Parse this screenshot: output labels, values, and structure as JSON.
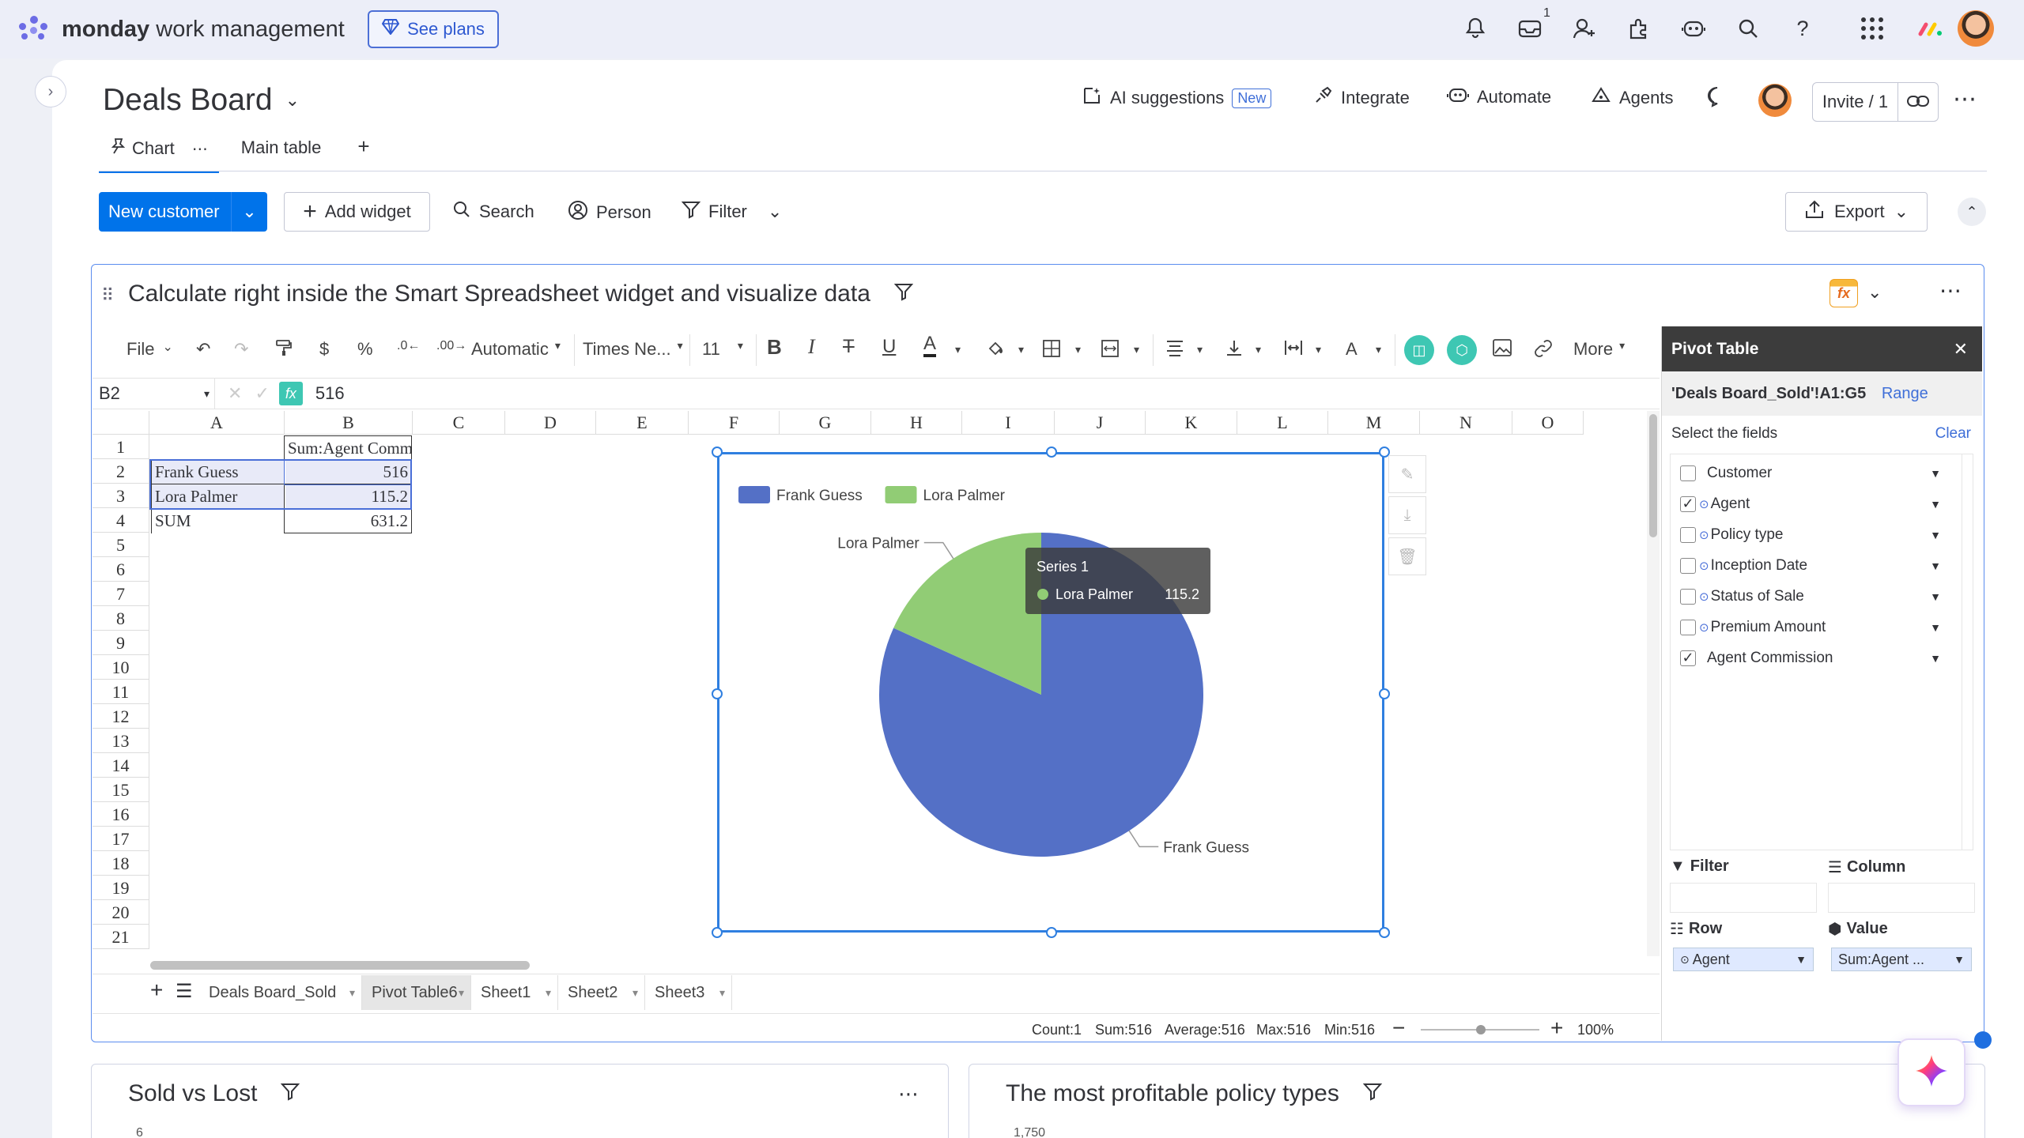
{
  "app": {
    "brand_bold": "monday",
    "brand_rest": " work management",
    "see_plans": "See plans",
    "inbox_badge": "1"
  },
  "board": {
    "title": "Deals Board",
    "ai_suggestions": "AI suggestions",
    "new_badge": "New",
    "integrate": "Integrate",
    "automate": "Automate",
    "agents": "Agents",
    "invite": "Invite / 1"
  },
  "tabs": [
    {
      "label": "Chart",
      "active": true
    },
    {
      "label": "Main table",
      "active": false
    }
  ],
  "toolbar": {
    "new_customer": "New customer",
    "add_widget": "Add widget",
    "search": "Search",
    "person": "Person",
    "filter": "Filter",
    "export": "Export"
  },
  "widget": {
    "title": "Calculate right inside the Smart Spreadsheet widget and visualize data"
  },
  "ss_toolbar": {
    "file": "File",
    "dollar": "$",
    "percent": "%",
    "format": "Automatic",
    "font": "Times Ne...",
    "size": "11",
    "more": "More"
  },
  "formula": {
    "cell_ref": "B2",
    "fx": "fx",
    "value": "516"
  },
  "sheet": {
    "columns": [
      "A",
      "B",
      "C",
      "D",
      "E",
      "F",
      "G",
      "H",
      "I",
      "J",
      "K",
      "L",
      "M",
      "N",
      "O"
    ],
    "rows": [
      "1",
      "2",
      "3",
      "4",
      "5",
      "6",
      "7",
      "8",
      "9",
      "10",
      "11",
      "12",
      "13",
      "14",
      "15",
      "16",
      "17",
      "18",
      "19",
      "20",
      "21"
    ],
    "b1": "Sum:Agent Commission",
    "a2": "Frank Guess",
    "b2": "516",
    "a3": "Lora Palmer",
    "b3": "115.2",
    "a4": "SUM",
    "b4": "631.2"
  },
  "chart_data": {
    "type": "pie",
    "categories": [
      "Frank Guess",
      "Lora Palmer"
    ],
    "series": [
      {
        "name": "Series 1",
        "values": [
          516,
          115.2
        ]
      }
    ],
    "colors": [
      "#5470c6",
      "#91cc75"
    ],
    "legend": "top-left",
    "tooltip": {
      "series": "Series 1",
      "label": "Lora Palmer",
      "value": "115.2"
    }
  },
  "sheet_tabs": [
    {
      "label": "Deals Board_Sold",
      "active": false
    },
    {
      "label": "Pivot Table6",
      "active": true
    },
    {
      "label": "Sheet1",
      "active": false
    },
    {
      "label": "Sheet2",
      "active": false
    },
    {
      "label": "Sheet3",
      "active": false
    }
  ],
  "status": {
    "count": "Count:1",
    "sum": "Sum:516",
    "average": "Average:516",
    "max": "Max:516",
    "min": "Min:516",
    "zoom": "100%"
  },
  "pivot": {
    "title": "Pivot Table",
    "range_ref": "'Deals Board_Sold'!A1:G5",
    "range_link": "Range",
    "select_fields": "Select the fields",
    "clear": "Clear",
    "fields": [
      {
        "label": "Customer",
        "checked": false,
        "linked": false
      },
      {
        "label": "Agent",
        "checked": true,
        "linked": true
      },
      {
        "label": "Policy type",
        "checked": false,
        "linked": true
      },
      {
        "label": "Inception Date",
        "checked": false,
        "linked": true
      },
      {
        "label": "Status of Sale",
        "checked": false,
        "linked": true
      },
      {
        "label": "Premium Amount",
        "checked": false,
        "linked": true
      },
      {
        "label": "Agent Commission",
        "checked": true,
        "linked": false
      }
    ],
    "filter": "Filter",
    "column": "Column",
    "row": "Row",
    "value": "Value",
    "row_pill": "Agent",
    "value_pill": "Sum:Agent ..."
  },
  "lower_widgets": [
    {
      "title": "Sold vs Lost",
      "tick": "6"
    },
    {
      "title": "The most profitable policy types",
      "tick": "1,750"
    }
  ]
}
